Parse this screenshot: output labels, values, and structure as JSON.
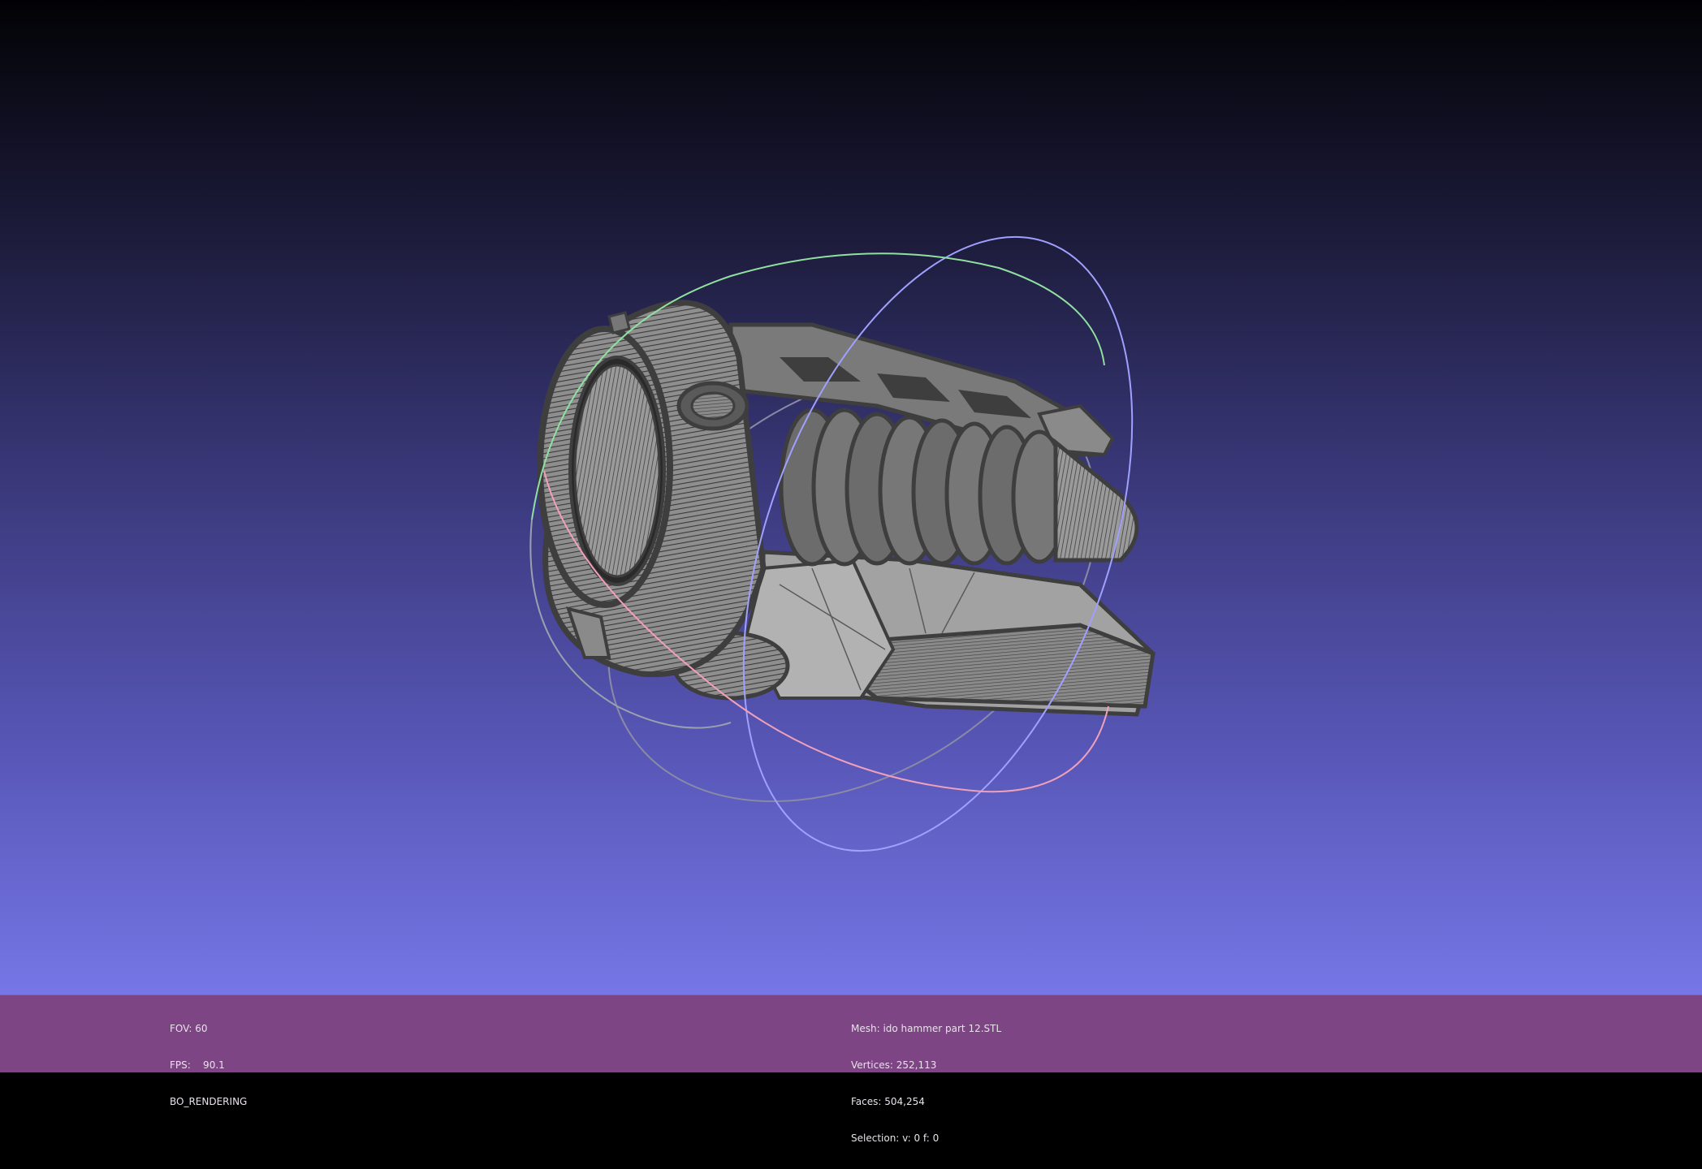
{
  "viewer": {
    "background_top": "#020205",
    "background_bottom": "#7676e6",
    "mesh_color": "#9a9a9a",
    "wire_color": "#3e3e3e"
  },
  "status_left": {
    "fov": "FOV: 60",
    "fps": "FPS:    90.1",
    "render_mode": "BO_RENDERING"
  },
  "status_mesh": {
    "mesh": "Mesh: ido hammer part 12.STL",
    "vertices": "Vertices: 252,113",
    "faces": "Faces: 504,254",
    "selection": "Selection: v: 0 f: 0"
  },
  "trackball": {
    "ring_colors": [
      "#9c9cff",
      "#8fe0a0",
      "#f0a0b8"
    ]
  }
}
